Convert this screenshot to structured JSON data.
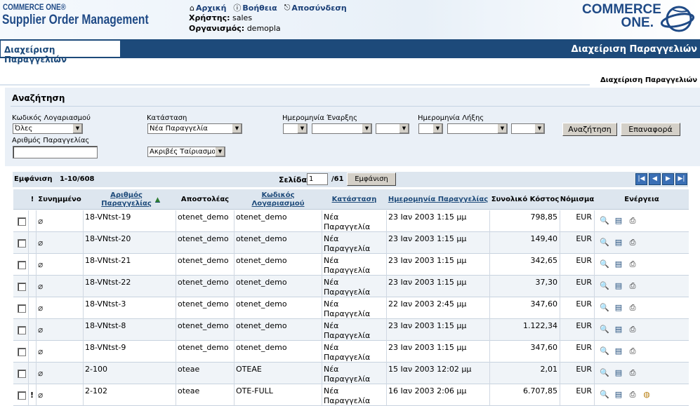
{
  "header": {
    "brand_small": "COMMERCE ONE®",
    "brand_big": "Supplier Order Management",
    "nav": [
      {
        "label": "Αρχική",
        "icon": "home-icon"
      },
      {
        "label": "Βοήθεια",
        "icon": "help-icon"
      },
      {
        "label": "Αποσύνδεση",
        "icon": "logout-icon"
      }
    ],
    "user_label": "Χρήστης:",
    "user_value": "sales",
    "org_label": "Οργανισμός:",
    "org_value": "demopla",
    "logo_line1": "COMMERCE",
    "logo_line2": "ONE."
  },
  "navbar": {
    "tab_label": "Διαχείριση Παραγγελιών",
    "title": "Διαχείριση Παραγγελιών"
  },
  "breadcrumb": "Διαχείριση Παραγγελιών",
  "search": {
    "title": "Αναζήτηση",
    "account_code_label": "Κωδικός Λογαριασμού",
    "account_code_value": "Όλες",
    "order_number_label": "Αριθμός Παραγγελίας",
    "order_number_value": "",
    "status_label": "Κατάσταση",
    "status_value": "Νέα Παραγγελία",
    "match_value": "Ακριβές Ταίριασμα",
    "start_date_label": "Ημερομηνία Έναρξης",
    "end_date_label": "Ημερομηνία Λήξης",
    "search_button": "Αναζήτηση",
    "reset_button": "Επαναφορά"
  },
  "results": {
    "show_label": "Εμφάνιση",
    "range": "1-10/608",
    "page_label": "Σελίδα",
    "page_value": "1",
    "page_total": "/61",
    "show_button": "Εμφάνιση"
  },
  "table": {
    "headers": {
      "excl": "!",
      "attached": "Συνημμένο",
      "order_number": "Αριθμός Παραγγελίας",
      "sender": "Αποστολέας",
      "account_code": "Κωδικός Λογαριασμού",
      "status": "Κατάσταση",
      "order_date": "Ημερομηνία Παραγγελίας",
      "total_cost": "Συνολικό Κόστος",
      "currency": "Νόμισμα",
      "actions": "Ενέργεια"
    },
    "rows": [
      {
        "flag": "",
        "order": "18-VNtst-19",
        "sender": "otenet_demo",
        "account": "otenet_demo",
        "status1": "Νέα",
        "status2": "Παραγγελία",
        "date": "23 Ιαν 2003 1:15 μμ",
        "total": "798,85",
        "currency": "EUR"
      },
      {
        "flag": "",
        "order": "18-VNtst-20",
        "sender": "otenet_demo",
        "account": "otenet_demo",
        "status1": "Νέα",
        "status2": "Παραγγελία",
        "date": "23 Ιαν 2003 1:15 μμ",
        "total": "149,40",
        "currency": "EUR"
      },
      {
        "flag": "",
        "order": "18-VNtst-21",
        "sender": "otenet_demo",
        "account": "otenet_demo",
        "status1": "Νέα",
        "status2": "Παραγγελία",
        "date": "23 Ιαν 2003 1:15 μμ",
        "total": "342,65",
        "currency": "EUR"
      },
      {
        "flag": "",
        "order": "18-VNtst-22",
        "sender": "otenet_demo",
        "account": "otenet_demo",
        "status1": "Νέα",
        "status2": "Παραγγελία",
        "date": "23 Ιαν 2003 1:15 μμ",
        "total": "37,30",
        "currency": "EUR"
      },
      {
        "flag": "",
        "order": "18-VNtst-3",
        "sender": "otenet_demo",
        "account": "otenet_demo",
        "status1": "Νέα",
        "status2": "Παραγγελία",
        "date": "22 Ιαν 2003 2:45 μμ",
        "total": "347,60",
        "currency": "EUR"
      },
      {
        "flag": "",
        "order": "18-VNtst-8",
        "sender": "otenet_demo",
        "account": "otenet_demo",
        "status1": "Νέα",
        "status2": "Παραγγελία",
        "date": "23 Ιαν 2003 1:15 μμ",
        "total": "1.122,34",
        "currency": "EUR"
      },
      {
        "flag": "",
        "order": "18-VNtst-9",
        "sender": "otenet_demo",
        "account": "otenet_demo",
        "status1": "Νέα",
        "status2": "Παραγγελία",
        "date": "23 Ιαν 2003 1:15 μμ",
        "total": "347,60",
        "currency": "EUR"
      },
      {
        "flag": "",
        "order": "2-100",
        "sender": "oteae",
        "account": "OTEAE",
        "status1": "Νέα",
        "status2": "Παραγγελία",
        "date": "15 Ιαν 2003 12:02 μμ",
        "total": "2,01",
        "currency": "EUR"
      },
      {
        "flag": "!",
        "order": "2-102",
        "sender": "oteae",
        "account": "OTE-FULL",
        "status1": "Νέα",
        "status2": "Παραγγελία",
        "date": "16 Ιαν 2003 2:06 μμ",
        "total": "6.707,85",
        "currency": "EUR"
      }
    ]
  }
}
